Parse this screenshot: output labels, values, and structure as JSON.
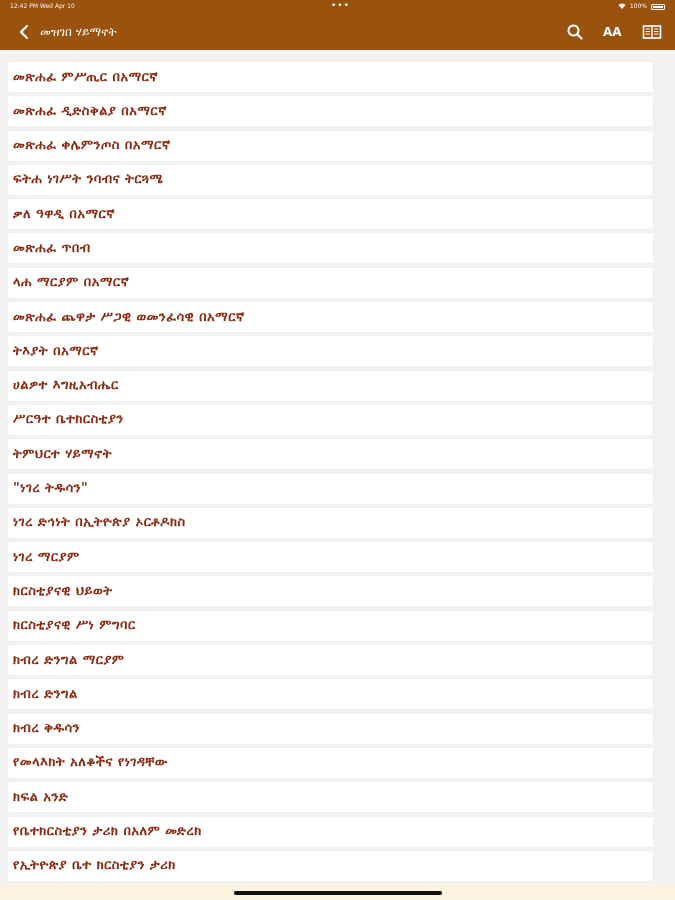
{
  "status_bar": {
    "time": "12:42 PM   Wed Apr 10",
    "dots": "•••",
    "battery_text": "100%"
  },
  "header": {
    "title": "መዝገበ ሃይማኖት",
    "icons": [
      "back-icon",
      "search-icon",
      "font-size-icon",
      "book-icon"
    ],
    "font_size_label": "AA"
  },
  "colors": {
    "header_bg": "#9a520f",
    "item_text": "#8b2a12",
    "page_bg": "#f2f2f2"
  },
  "list": {
    "items": [
      "መጽሐፈ ምሥጢር በአማርኛ",
      "መጽሐፈ ዲድስቅልያ በአማርኛ",
      "መጽሐፈ ቀሌምንጦስ በአማርኛ",
      "ፍትሐ ነገሥት ንባብና ትርጓሜ",
      "ቃለ ዓዋዲ በአማርኛ",
      "መጽሐፈ ጥበብ",
      "ላሐ ማርያም በአማርኛ",
      "መጽሐፈ ጨዋታ ሥጋዊ ወመንፈሳዊ በአማርኛ",
      "ትእያት በአማርኛ",
      "ሀልዎተ እግዚአብሔር",
      "ሥርዓተ ቤተክርስቲያን",
      "ትምህርተ ሃይማኖት",
      "\"ነገረ ትዱሳን\"",
      "ነገረ ድኅነት በኢትዮጵያ ኦርቶዶክስ",
      "ነገረ ማርያም",
      "ክርስቲያናዊ ህይወት",
      "ክርስቲያናዊ ሥነ ምግባር",
      "ክብረ ድንግል ማርያም",
      "ክብረ ድንግል",
      "ክብረ ቅዱሳን",
      "የመላእክት አለቆችና የነገዳቸው",
      "ክፍል አንድ",
      "የቤተክርስቲያን ታሪክ በአለም መድረክ",
      "የኢትዮጵያ ቤተ ክርስቲያን ታሪክ"
    ]
  }
}
